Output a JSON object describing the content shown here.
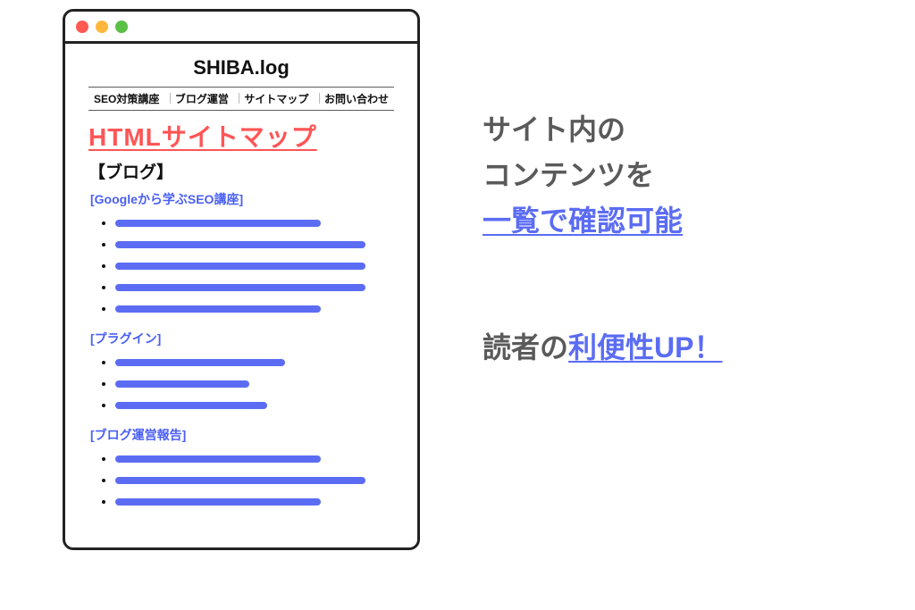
{
  "browser": {
    "site_title": "SHIBA.log",
    "nav": [
      "SEO対策講座",
      "ブログ運営",
      "サイトマップ",
      "お問い合わせ"
    ],
    "page_heading": "HTMLサイトマップ",
    "section_title": "【ブログ】",
    "subsections": {
      "s1": "[Googleから学ぶSEO講座]",
      "s2": "[プラグイン]",
      "s3": "[ブログ運営報告]"
    }
  },
  "caption": {
    "line1": "サイト内の",
    "line2": "コンテンツを",
    "line3": "一覧で確認可能",
    "line4a": "読者の",
    "line4b": "利便性UP！"
  }
}
